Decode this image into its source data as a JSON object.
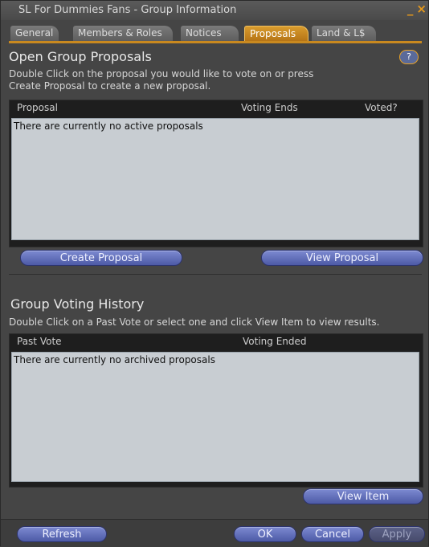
{
  "window": {
    "title": "SL For Dummies Fans - Group Information",
    "minimize_glyph": "_",
    "close_glyph": "×"
  },
  "tabs": [
    {
      "label": "General"
    },
    {
      "label": "Members & Roles"
    },
    {
      "label": "Notices"
    },
    {
      "label": "Proposals"
    },
    {
      "label": "Land & L$"
    }
  ],
  "active_tab": "Proposals",
  "open_proposals": {
    "heading": "Open Group Proposals",
    "desc_line1": "Double Click on the proposal you would like to vote on or press",
    "desc_line2": "Create Proposal to create a new proposal.",
    "help_label": "?",
    "columns": {
      "proposal": "Proposal",
      "voting_ends": "Voting Ends",
      "voted": "Voted?"
    },
    "empty_text": "There are currently no active proposals",
    "create_button": "Create Proposal",
    "view_button": "View Proposal"
  },
  "voting_history": {
    "heading": "Group Voting History",
    "desc": "Double Click on a Past Vote or select one and click View Item to view results.",
    "columns": {
      "past_vote": "Past Vote",
      "voting_ended": "Voting Ended"
    },
    "empty_text": "There are currently no archived proposals",
    "view_item_button": "View Item"
  },
  "footer": {
    "refresh": "Refresh",
    "ok": "OK",
    "cancel": "Cancel",
    "apply": "Apply"
  },
  "colors": {
    "accent": "#d89b2d",
    "button": "#5d6ab8",
    "list_bg": "#c8cdd2",
    "window_bg": "#454545"
  }
}
